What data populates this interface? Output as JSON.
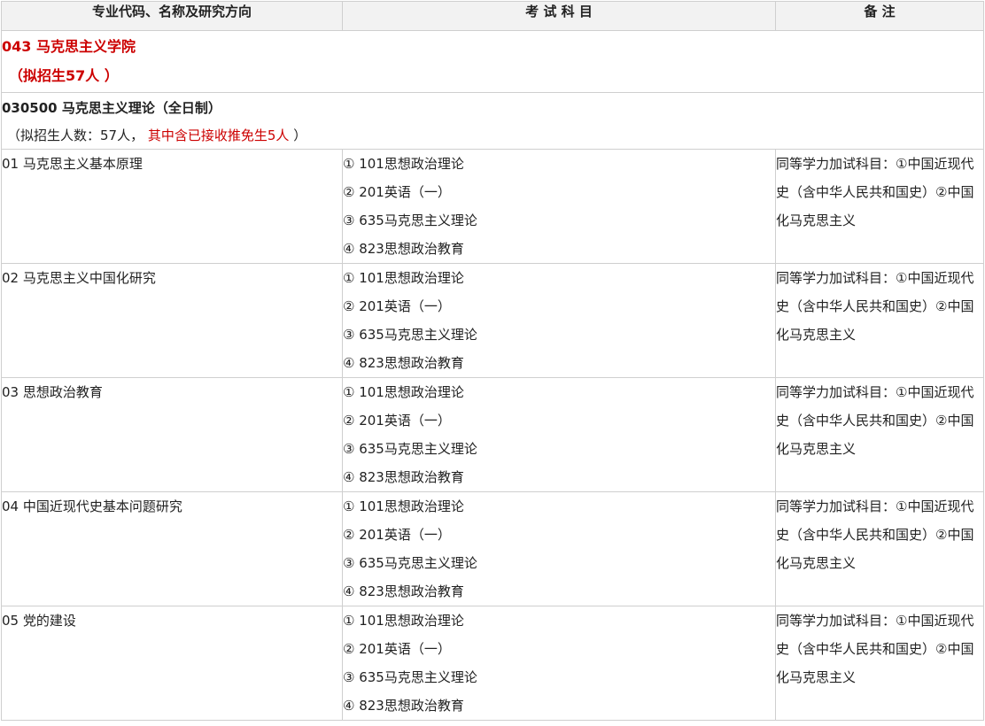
{
  "headers": {
    "col1": "专业代码、名称及研究方向",
    "col2": "考 试 科 目",
    "col3": "备 注"
  },
  "school": {
    "name": "043 马克思主义学院",
    "quota": "（拟招生57人 ）"
  },
  "major": {
    "name": "030500 马克思主义理论（全日制）",
    "quota_prefix": "（拟招生人数：57人，",
    "quota_red": "其中含已接收推免生5人",
    "quota_suffix": "）"
  },
  "directions": [
    {
      "name": "01 马克思主义基本原理",
      "subjects": [
        "① 101思想政治理论",
        "② 201英语（一）",
        "③ 635马克思主义理论",
        "④ 823思想政治教育"
      ],
      "note": "同等学力加试科目：①中国近现代史（含中华人民共和国史）②中国化马克思主义"
    },
    {
      "name": "02 马克思主义中国化研究",
      "subjects": [
        "① 101思想政治理论",
        "② 201英语（一）",
        "③ 635马克思主义理论",
        "④ 823思想政治教育"
      ],
      "note": "同等学力加试科目：①中国近现代史（含中华人民共和国史）②中国化马克思主义"
    },
    {
      "name": "03 思想政治教育",
      "subjects": [
        "① 101思想政治理论",
        "② 201英语（一）",
        "③ 635马克思主义理论",
        "④ 823思想政治教育"
      ],
      "note": "同等学力加试科目：①中国近现代史（含中华人民共和国史）②中国化马克思主义"
    },
    {
      "name": "04 中国近现代史基本问题研究",
      "subjects": [
        "① 101思想政治理论",
        "② 201英语（一）",
        "③ 635马克思主义理论",
        "④ 823思想政治教育"
      ],
      "note": "同等学力加试科目：①中国近现代史（含中华人民共和国史）②中国化马克思主义"
    },
    {
      "name": "05 党的建设",
      "subjects": [
        "① 101思想政治理论",
        "② 201英语（一）",
        "③ 635马克思主义理论",
        "④ 823思想政治教育"
      ],
      "note": "同等学力加试科目：①中国近现代史（含中华人民共和国史）②中国化马克思主义"
    }
  ]
}
